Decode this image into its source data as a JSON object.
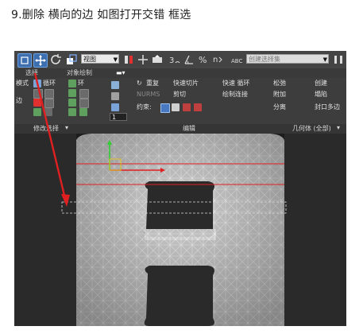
{
  "caption": "9.删除 横向的边 如图打开交错 框选",
  "toolbar": {
    "view_dropdown": "视图",
    "named_selection_dropdown": "创建选择集",
    "snap_3": "3",
    "snap_percent": "%",
    "snap_n": "n"
  },
  "ribbon_tabs": {
    "select_tab": "选择",
    "object_paint_tab": "对象绘制"
  },
  "ribbon": {
    "left_label_1": "模式",
    "left_label_2": "边",
    "ring_label": "环",
    "loop_label": "循环",
    "repeat_label": "重复",
    "nurms_label": "NURMS",
    "quickslice_label": "快速切片",
    "cut_label": "剪切",
    "quickloop_label": "快速 循环",
    "paint_connect_label": "绘制连接",
    "constraint_label": "约束:",
    "relax_label": "松弛",
    "create_label": "创建",
    "attach_label": "附加",
    "collapse_label": "塌陷",
    "cap_label": "分离",
    "cap_poly_label": "封口多边",
    "spinner_value": "1",
    "modify_select_label": "修改选择",
    "edit_label": "编辑",
    "geometry_label": "几何体 (全部)"
  },
  "colors": {
    "arrow": "#e02020",
    "mesh_fill": "#cfcfcf",
    "selection_edge": "#e02020"
  }
}
